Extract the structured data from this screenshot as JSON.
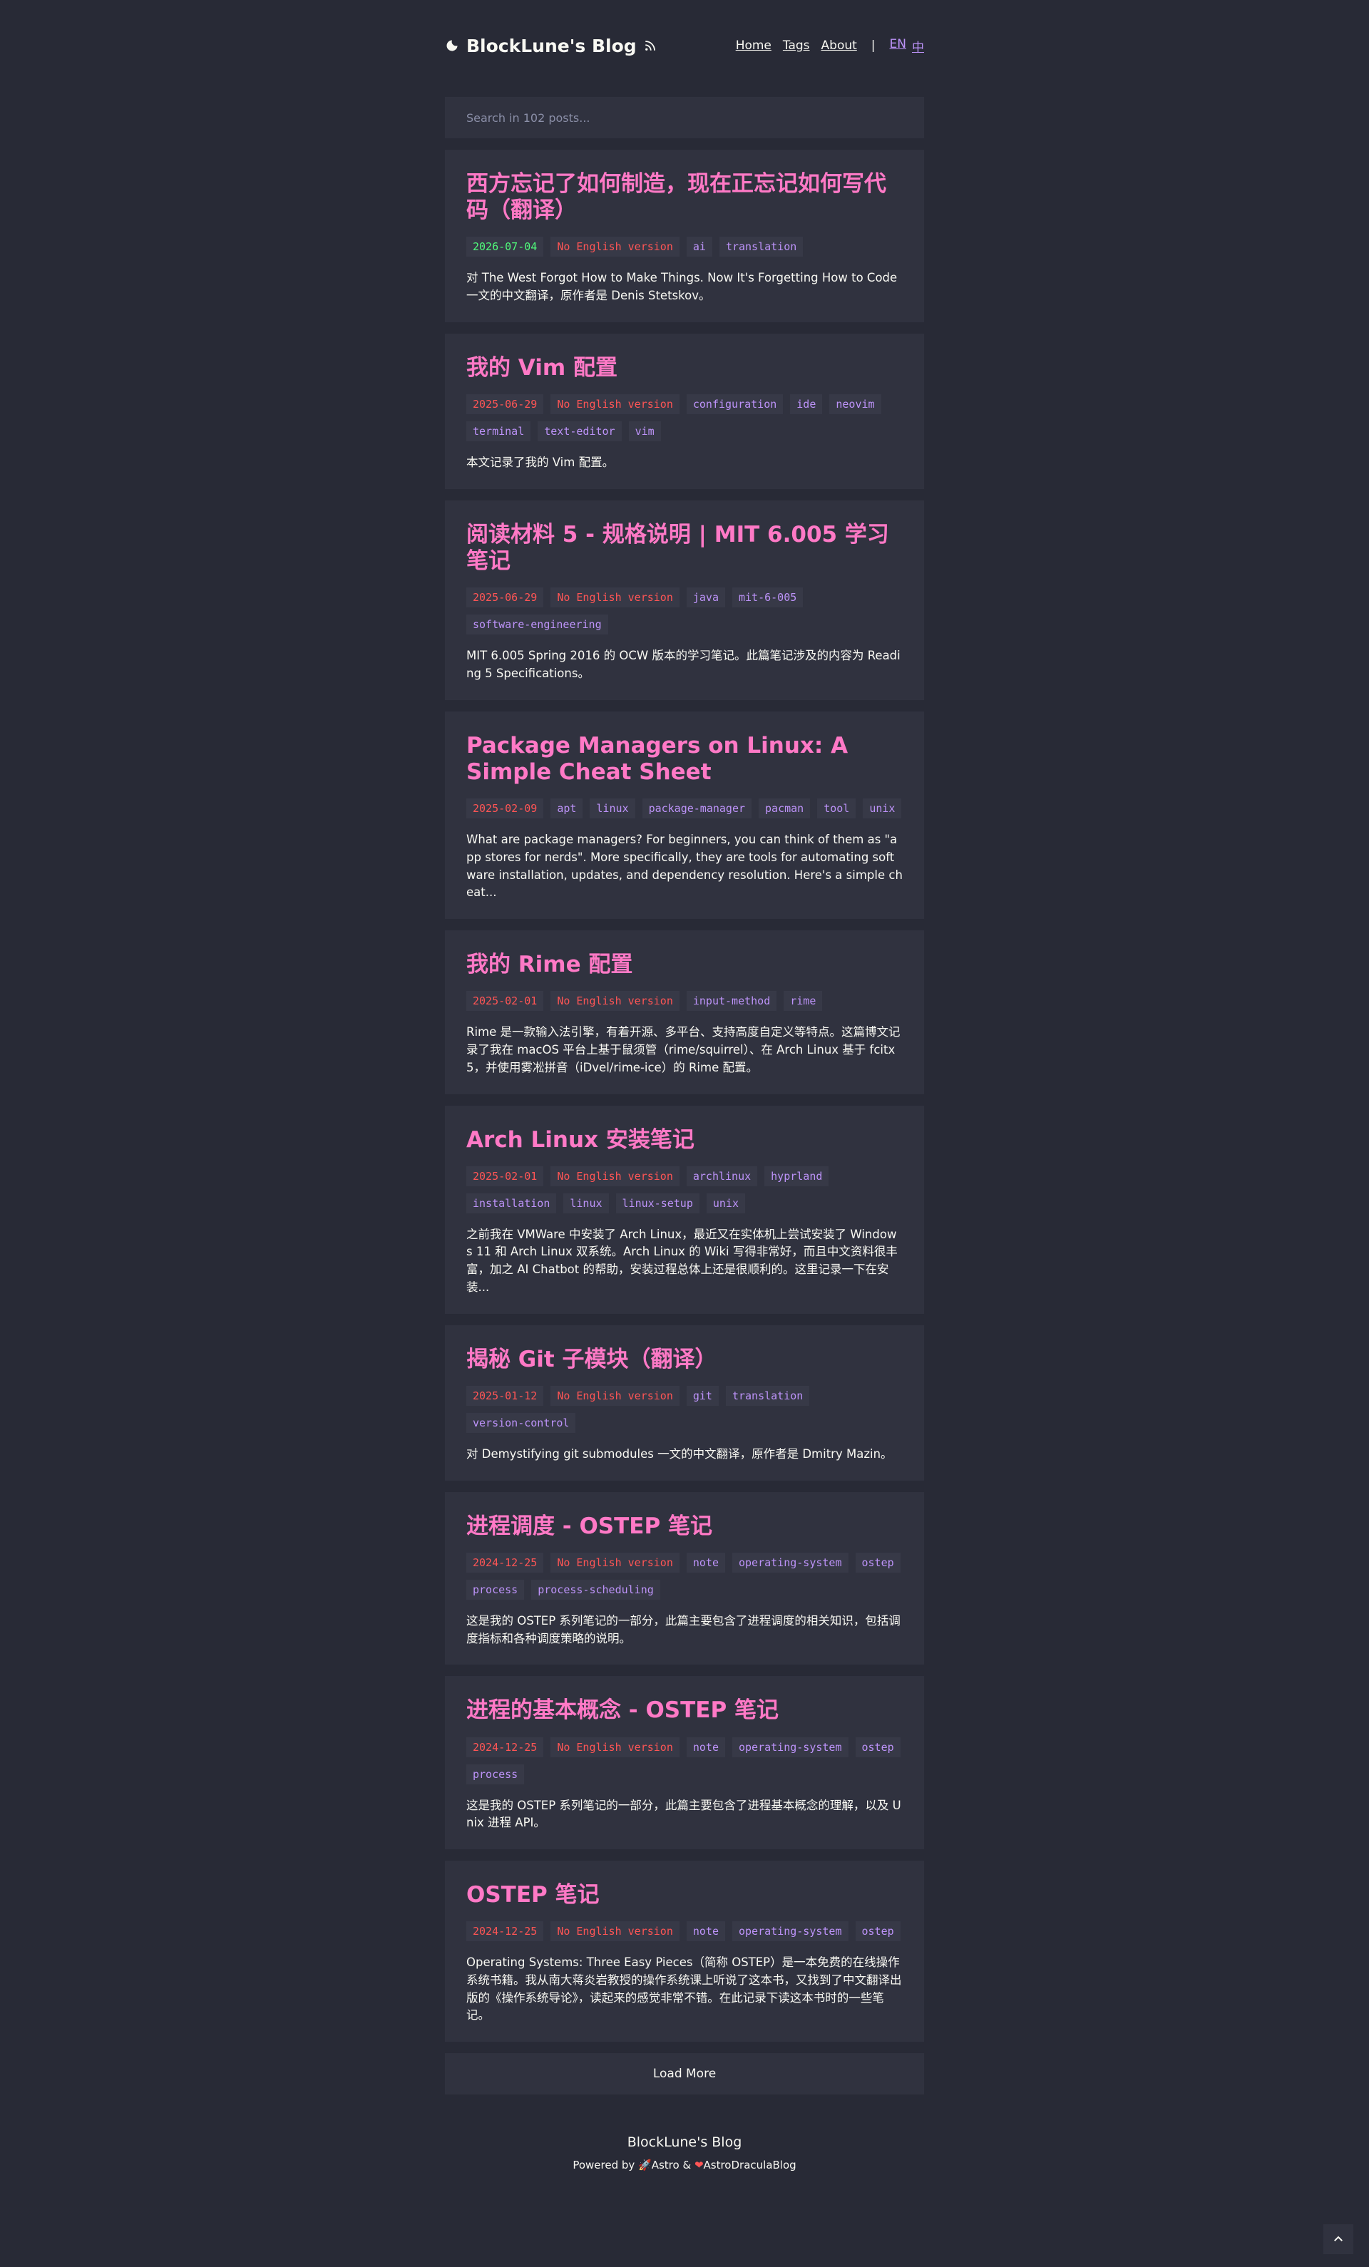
{
  "header": {
    "title": "BlockLune's Blog",
    "nav": [
      "Home",
      "Tags",
      "About"
    ],
    "separator": "|",
    "lang": [
      "EN",
      "中"
    ]
  },
  "search": {
    "placeholder": "Search in 102 posts..."
  },
  "posts": [
    {
      "title": "西方忘记了如何制造，现在正忘记如何写代码（翻译）",
      "date": "2026-07-04",
      "no_english": "No English version",
      "tags": [
        "ai",
        "translation"
      ],
      "excerpt": "对 The West Forgot How to Make Things. Now It's Forgetting How to Code 一文的中文翻译，原作者是 Denis Stetskov。"
    },
    {
      "title": "我的 Vim 配置",
      "date": "2025-06-29",
      "no_english": "No English version",
      "tags": [
        "configuration",
        "ide",
        "neovim",
        "terminal",
        "text-editor",
        "vim"
      ],
      "excerpt": "本文记录了我的 Vim 配置。"
    },
    {
      "title": "阅读材料 5 - 规格说明 | MIT 6.005 学习笔记",
      "date": "2025-06-29",
      "no_english": "No English version",
      "tags": [
        "java",
        "mit-6-005",
        "software-engineering"
      ],
      "excerpt": "MIT 6.005 Spring 2016 的 OCW 版本的学习笔记。此篇笔记涉及的内容为 Reading 5 Specifications。"
    },
    {
      "title": "Package Managers on Linux: A Simple Cheat Sheet",
      "date": "2025-02-09",
      "no_english": "",
      "tags": [
        "apt",
        "linux",
        "package-manager",
        "pacman",
        "tool",
        "unix"
      ],
      "excerpt": "What are package managers? For beginners, you can think of them as \"app stores for nerds\". More specifically, they are tools for automating software installation, updates, and dependency resolution. Here's a simple cheat..."
    },
    {
      "title": "我的 Rime 配置",
      "date": "2025-02-01",
      "no_english": "No English version",
      "tags": [
        "input-method",
        "rime"
      ],
      "excerpt": "Rime 是一款输入法引擎，有着开源、多平台、支持高度自定义等特点。这篇博文记录了我在 macOS 平台上基于鼠须管（rime/squirrel）、在 Arch Linux 基于 fcitx5，并使用雾凇拼音（iDvel/rime-ice）的 Rime 配置。"
    },
    {
      "title": "Arch Linux 安装笔记",
      "date": "2025-02-01",
      "no_english": "No English version",
      "tags": [
        "archlinux",
        "hyprland",
        "installation",
        "linux",
        "linux-setup",
        "unix"
      ],
      "excerpt": "之前我在 VMWare 中安装了 Arch Linux，最近又在实体机上尝试安装了 Windows 11 和 Arch Linux 双系统。Arch Linux 的 Wiki 写得非常好，而且中文资料很丰富，加之 AI Chatbot 的帮助，安装过程总体上还是很顺利的。这里记录一下在安装..."
    },
    {
      "title": "揭秘 Git 子模块（翻译）",
      "date": "2025-01-12",
      "no_english": "No English version",
      "tags": [
        "git",
        "translation",
        "version-control"
      ],
      "excerpt": "对 Demystifying git submodules 一文的中文翻译，原作者是 Dmitry Mazin。"
    },
    {
      "title": "进程调度 - OSTEP 笔记",
      "date": "2024-12-25",
      "no_english": "No English version",
      "tags": [
        "note",
        "operating-system",
        "ostep",
        "process",
        "process-scheduling"
      ],
      "excerpt": "这是我的 OSTEP 系列笔记的一部分，此篇主要包含了进程调度的相关知识，包括调度指标和各种调度策略的说明。"
    },
    {
      "title": "进程的基本概念 - OSTEP 笔记",
      "date": "2024-12-25",
      "no_english": "No English version",
      "tags": [
        "note",
        "operating-system",
        "ostep",
        "process"
      ],
      "excerpt": "这是我的 OSTEP 系列笔记的一部分，此篇主要包含了进程基本概念的理解，以及 Unix 进程 API。"
    },
    {
      "title": "OSTEP 笔记",
      "date": "2024-12-25",
      "no_english": "No English version",
      "tags": [
        "note",
        "operating-system",
        "ostep"
      ],
      "excerpt": "Operating Systems: Three Easy Pieces（简称 OSTEP）是一本免费的在线操作系统书籍。我从南大蒋炎岩教授的操作系统课上听说了这本书，又找到了中文翻译出版的《操作系统导论》，读起来的感觉非常不错。在此记录下读这本书时的一些笔记。"
    }
  ],
  "load_more": "Load More",
  "footer": {
    "title": "BlockLune's Blog",
    "powered_prefix": "Powered by ",
    "astro": "Astro",
    "amp": " & ",
    "theme": "AstroDraculaBlog"
  },
  "colors": {
    "background": "#282a36",
    "card": "#30323f",
    "title_pink": "#ff79c6",
    "tag_purple": "#bd93f9",
    "date_red": "#ff5555",
    "date_green": "#50fa7b"
  }
}
